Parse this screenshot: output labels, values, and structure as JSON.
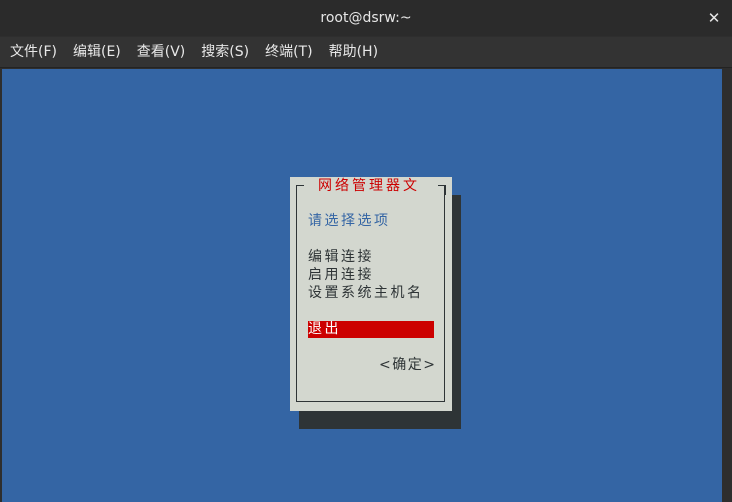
{
  "window": {
    "title": "root@dsrw:~",
    "close_glyph": "✕"
  },
  "menubar": {
    "items": [
      {
        "label": "文件(F)"
      },
      {
        "label": "编辑(E)"
      },
      {
        "label": "查看(V)"
      },
      {
        "label": "搜索(S)"
      },
      {
        "label": "终端(T)"
      },
      {
        "label": "帮助(H)"
      }
    ]
  },
  "dialog": {
    "title": "网络管理器文",
    "prompt": "请选择选项",
    "options": [
      {
        "label": "编辑连接"
      },
      {
        "label": "启用连接"
      },
      {
        "label": "设置系统主机名"
      },
      {
        "label": "退出",
        "selected": true
      }
    ],
    "ok_label": "<确定>"
  },
  "colors": {
    "terminal_bg": "#3465a4",
    "dialog_bg": "#d3d7cf",
    "accent_red": "#cc0000",
    "prompt_blue": "#3465a4"
  }
}
